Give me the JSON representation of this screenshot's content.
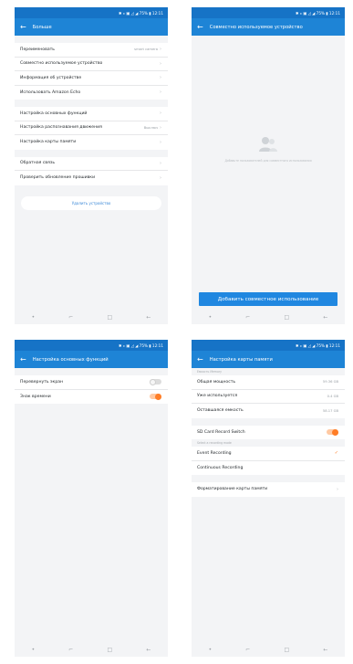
{
  "screens": {
    "more": {
      "title": "Больше",
      "groups": [
        [
          {
            "label": "Переименовать",
            "value": "smart camera"
          },
          {
            "label": "Совместно используемое устройство",
            "value": ""
          },
          {
            "label": "Информация об устройстве",
            "value": ""
          },
          {
            "label": "Использовать Amazon Echo",
            "value": ""
          }
        ],
        [
          {
            "label": "Настройка основных функций",
            "value": ""
          },
          {
            "label": "Настройка распознавания движения",
            "value": "Выключ"
          },
          {
            "label": "Настройка карты памяти",
            "value": ""
          }
        ],
        [
          {
            "label": "Обратная связь",
            "value": ""
          },
          {
            "label": "Проверить обновление прошивки",
            "value": ""
          }
        ]
      ],
      "remove_label": "Удалить устройство"
    },
    "shared": {
      "title": "Совместно используемое устройство",
      "empty_text": "Добавьте пользователей для совместного использования",
      "add_label": "Добавить совместное использование"
    },
    "basic": {
      "title": "Настройка основных функций",
      "rows": [
        {
          "label": "Перевернуть экран",
          "on": false
        },
        {
          "label": "Знак времени",
          "on": true
        }
      ]
    },
    "sd": {
      "title": "Настройка карты памяти",
      "section1": "Емкость Memory",
      "rows": [
        {
          "label": "Общая мощность",
          "value": "59.36 GB"
        },
        {
          "label": "Уже используется",
          "value": "0.4 GB"
        },
        {
          "label": "Оставшаяся емкость",
          "value": "58.17 GB"
        }
      ],
      "switch_label": "SD Card Record Switch",
      "switch_on": true,
      "section2": "Select a recording mode",
      "modes": [
        {
          "label": "Event Recording",
          "selected": true
        },
        {
          "label": "Continuous Recording",
          "selected": false
        }
      ],
      "format_label": "Форматирование карты памяти"
    }
  },
  "status": {
    "right": "✱ ⁎ ▣ ◿ ◢ 75% ▮ 12:11"
  },
  "icons": {
    "back": "arrow-back-icon",
    "chevron": "chevron-right-icon",
    "check": "check-icon",
    "users": "users-icon"
  },
  "nav_glyphs": {
    "dot": "•",
    "recent": "⌐",
    "home": "□",
    "back": "←"
  },
  "colors": {
    "primary": "#1e84d6",
    "status": "#1673c6",
    "accent": "#ff7d26",
    "background": "#f3f4f6"
  }
}
